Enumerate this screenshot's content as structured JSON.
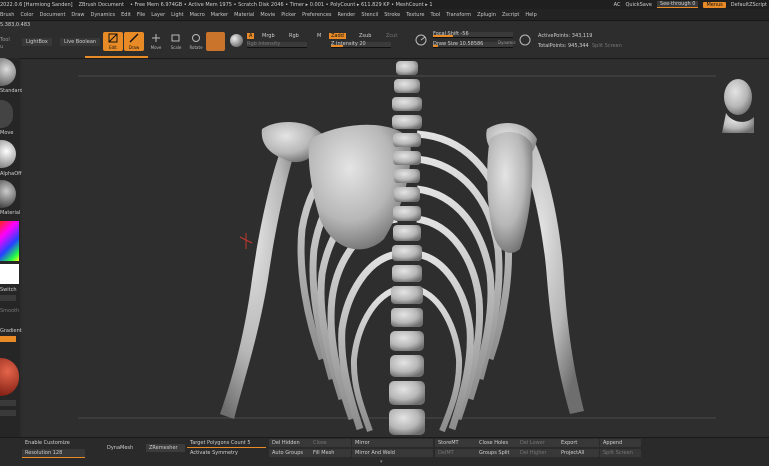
{
  "title_bar": {
    "items": [
      "2022.0.6 [Harmiong Sanden]",
      "ZBrush Document",
      "• Free Mem 6.974GB • Active Mem 1975 • Scratch Disk 2046 • Timer ▸ 0.001 • PolyCount ▸ 611.829 KP • MeshCount ▸ 1"
    ],
    "ac": "AC",
    "quicksave": "QuickSave",
    "see_through": "See-through  0",
    "menus": "Menus",
    "script": "DefaultZScript"
  },
  "menu_bar": [
    "Brush",
    "Color",
    "Document",
    "Draw",
    "Dynamics",
    "Edit",
    "File",
    "Layer",
    "Light",
    "Macro",
    "Marker",
    "Material",
    "Movie",
    "Picker",
    "Preferences",
    "Render",
    "Stencil",
    "Stroke",
    "Texture",
    "Tool",
    "Transform",
    "Zplugin",
    "Zscript",
    "Help"
  ],
  "toolbar": {
    "coords": "5.383,0.483",
    "lightbox": "LightBox",
    "live_boolean": "Live Boolean",
    "edit": "Edit",
    "draw": "Draw",
    "move": "Move",
    "scale": "Scale",
    "rotate": "Rotate",
    "a": "A",
    "mrgb": "Mrgb",
    "rgb": "Rgb",
    "m": "M",
    "zadd": "Zadd",
    "zsub": "Zsub",
    "zcut": "Zcut",
    "rgb_intensity": "Rgb Intensity",
    "z_intensity": "Z Intensity 20",
    "focal_shift": "Focal Shift -56",
    "draw_size": "Draw Size 10.58586",
    "dynamic": "Dynamic",
    "active_points": "ActivePoints: 343,119",
    "total_points": "TotalPoints: 945,344",
    "split_screen": "Split Screen",
    "tool_label_a": "Tool",
    "tool_label_b": "u"
  },
  "left_shelf": {
    "labels": [
      "Standard",
      "Move",
      "Dots",
      "AlphaOff",
      "Material",
      "Switch",
      "Flat",
      "Smooth",
      "Gradient"
    ]
  },
  "bottom_bar": {
    "enable_customize": "Enable Customize",
    "resolution": "Resolution 128",
    "dynamesh": "DynaMesh",
    "zremesher": "ZRemesher",
    "target_polygons": "Target Polygons Count 5",
    "activate_symmetry": "Activate Symmetry",
    "del_hidden": "Del Hidden",
    "auto_groups": "Auto Groups",
    "close": "Close",
    "mirror": "Mirror",
    "split_unmasked": "Split Unmasked Points",
    "fill_mesh": "Fill Mesh",
    "mirror_and_weld": "Mirror And Weld",
    "store_mt": "StoreMT",
    "del_mt": "DelMT",
    "close_holes": "Close Holes",
    "groups_split": "Groups Split",
    "del_lower": "Del Lower",
    "del_higher": "Del Higher",
    "export": "Export",
    "project_all": "ProjectAll",
    "append": "Append",
    "split_screen": "Split Screen"
  },
  "colors": {
    "accent": "#e88a25",
    "background": "#2e2e2e"
  }
}
